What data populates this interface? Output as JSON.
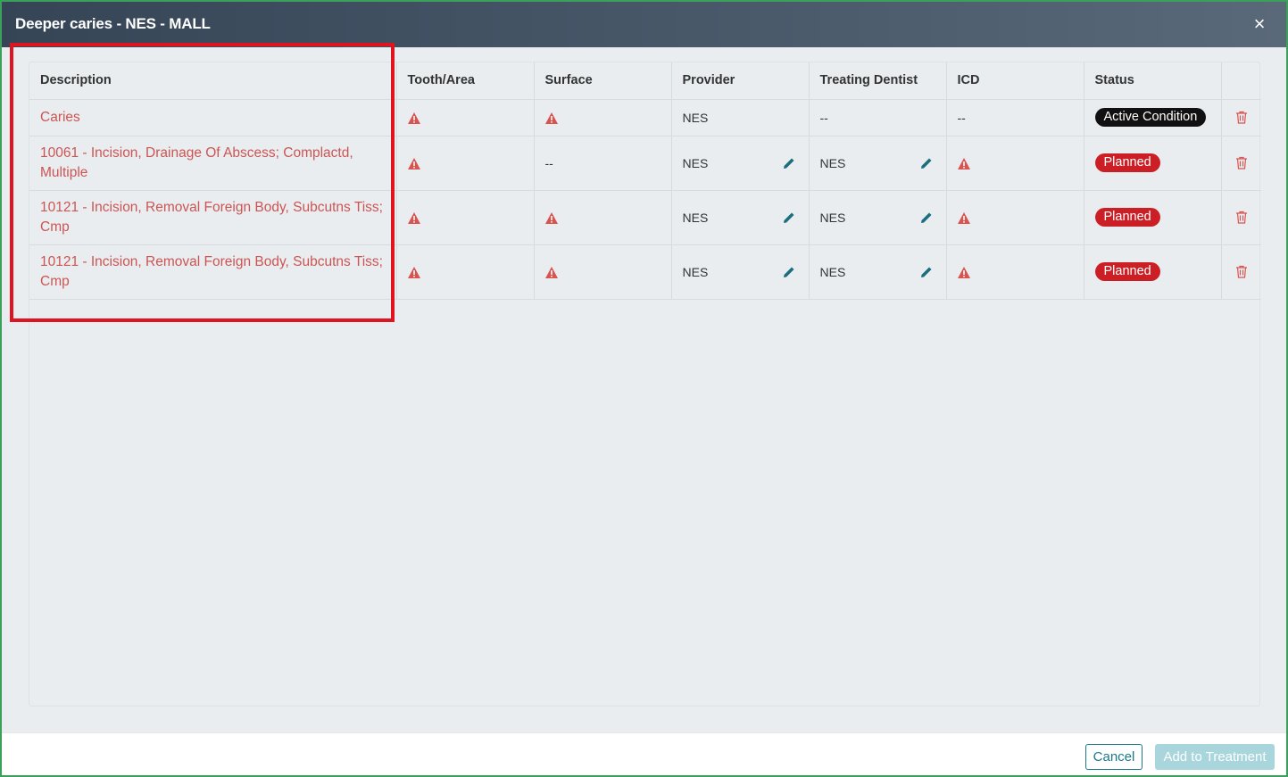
{
  "modal": {
    "title": "Deeper caries - NES - MALL",
    "close_label": "×"
  },
  "table": {
    "headers": {
      "description": "Description",
      "tooth_area": "Tooth/Area",
      "surface": "Surface",
      "provider": "Provider",
      "treating_dentist": "Treating Dentist",
      "icd": "ICD",
      "status": "Status"
    },
    "rows": [
      {
        "description": "Caries",
        "surface": "",
        "provider": "NES",
        "treating_dentist": "--",
        "icd": "--",
        "status": "Active Condition"
      },
      {
        "description": "10061 - Incision, Drainage Of Abscess; Complactd, Multiple",
        "surface": "--",
        "provider": "NES",
        "treating_dentist": "NES",
        "icd": "",
        "status": "Planned"
      },
      {
        "description": "10121 - Incision, Removal Foreign Body, Subcutns Tiss; Cmp",
        "surface": "",
        "provider": "NES",
        "treating_dentist": "NES",
        "icd": "",
        "status": "Planned"
      },
      {
        "description": "10121 - Incision, Removal Foreign Body, Subcutns Tiss; Cmp",
        "surface": "",
        "provider": "NES",
        "treating_dentist": "NES",
        "icd": "",
        "status": "Planned"
      }
    ]
  },
  "footer": {
    "cancel_label": "Cancel",
    "add_label": "Add to Treatment"
  },
  "colors": {
    "warning": "#d9534f",
    "edit_icon": "#1a6f7e",
    "planned_badge": "#cc1f25",
    "active_badge": "#111111",
    "highlight_border": "#e0141e"
  }
}
